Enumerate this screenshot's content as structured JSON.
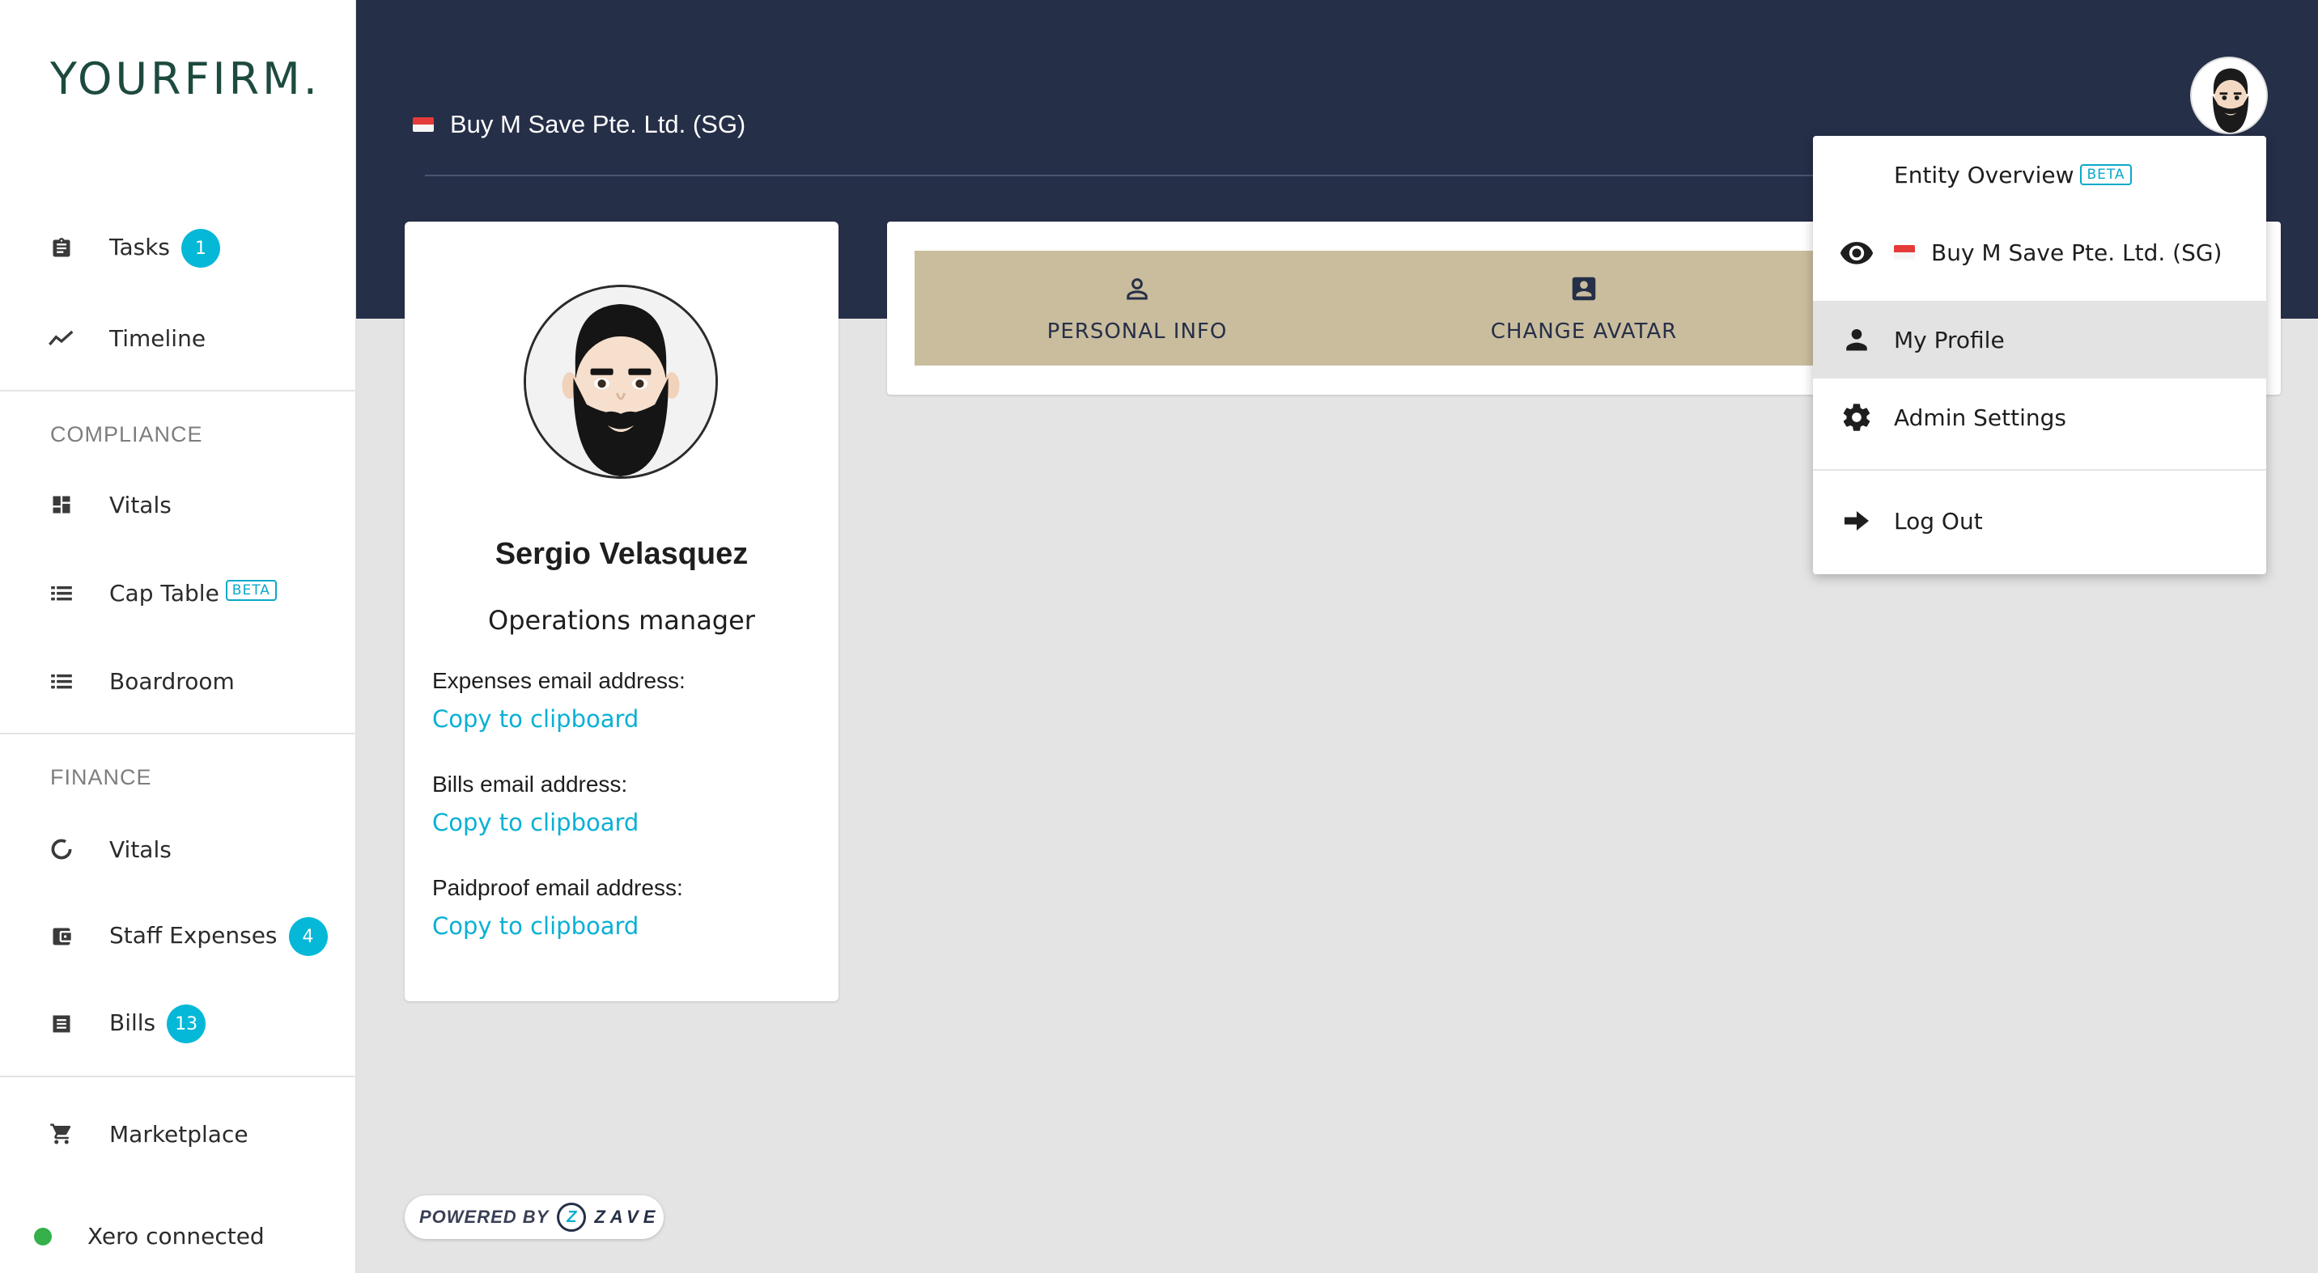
{
  "sidebar": {
    "logo_your": "YOUR",
    "logo_firm": "FIRM.",
    "items": [
      {
        "label": "Tasks",
        "badge": "1",
        "icon": "clipboard-icon"
      },
      {
        "label": "Timeline",
        "icon": "trending-icon"
      }
    ],
    "compliance": {
      "title": "COMPLIANCE",
      "items": [
        {
          "label": "Vitals",
          "icon": "dashboard-icon"
        },
        {
          "label": "Cap Table",
          "beta": "BETA",
          "icon": "list-icon"
        },
        {
          "label": "Boardroom",
          "icon": "list-icon"
        }
      ]
    },
    "finance": {
      "title": "FINANCE",
      "items": [
        {
          "label": "Vitals",
          "icon": "donut-icon"
        },
        {
          "label": "Staff Expenses",
          "badge": "4",
          "icon": "wallet-icon"
        },
        {
          "label": "Bills",
          "badge": "13",
          "icon": "receipt-icon"
        }
      ]
    },
    "marketplace": {
      "label": "Marketplace",
      "icon": "cart-icon"
    },
    "xero": {
      "label": "Xero connected",
      "status_color": "#35b04a"
    }
  },
  "header": {
    "entity_name": "Buy M Save Pte. Ltd. (SG)",
    "background": "#262f48"
  },
  "profile": {
    "name": "Sergio Velasquez",
    "role": "Operations manager",
    "fields": [
      {
        "label": "Expenses email address:",
        "link": "Copy to clipboard"
      },
      {
        "label": "Bills email address:",
        "link": "Copy to clipboard"
      },
      {
        "label": "Paidproof email address:",
        "link": "Copy to clipboard"
      }
    ]
  },
  "tabs": [
    {
      "label": "PERSONAL INFO",
      "icon": "person-outline-icon"
    },
    {
      "label": "CHANGE AVATAR",
      "icon": "account-box-icon"
    }
  ],
  "menu": {
    "entity_overview": "Entity Overview",
    "beta": "BETA",
    "current_entity": "Buy M Save Pte. Ltd. (SG)",
    "my_profile": "My Profile",
    "admin_settings": "Admin Settings",
    "log_out": "Log Out"
  },
  "powered": {
    "text": "POWERED BY",
    "brand": "ZAVE"
  },
  "colors": {
    "accent": "#06b8d8",
    "tab_bar": "#c9bd9e",
    "link": "#0ab0d4"
  }
}
